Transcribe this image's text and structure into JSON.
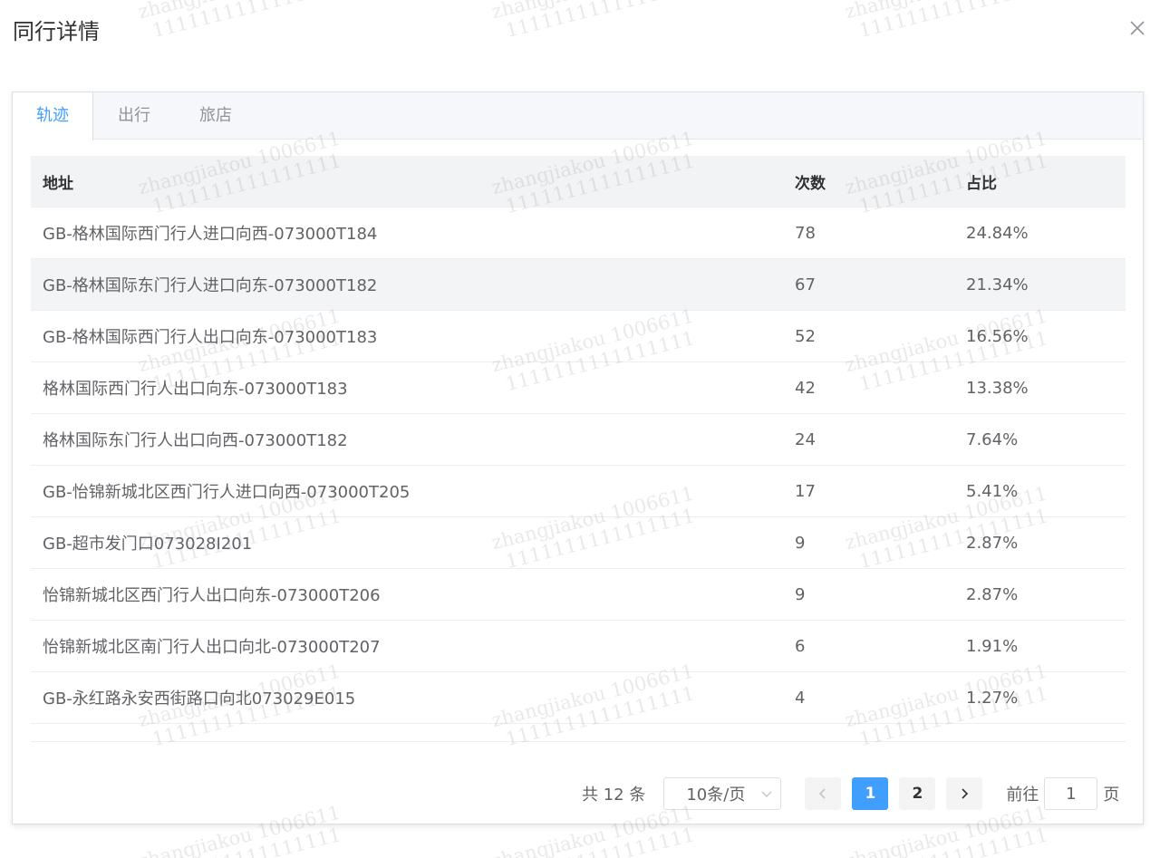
{
  "dialog": {
    "title": "同行详情"
  },
  "tabs": [
    {
      "label": "轨迹",
      "active": true
    },
    {
      "label": "出行",
      "active": false
    },
    {
      "label": "旅店",
      "active": false
    }
  ],
  "table": {
    "columns": [
      "地址",
      "次数",
      "占比"
    ],
    "rows": [
      {
        "address": "GB-格林国际西门行人进口向西-073000T184",
        "count": "78",
        "ratio": "24.84%"
      },
      {
        "address": "GB-格林国际东门行人进口向东-073000T182",
        "count": "67",
        "ratio": "21.34%"
      },
      {
        "address": "GB-格林国际西门行人出口向东-073000T183",
        "count": "52",
        "ratio": "16.56%"
      },
      {
        "address": "格林国际西门行人出口向东-073000T183",
        "count": "42",
        "ratio": "13.38%"
      },
      {
        "address": "格林国际东门行人出口向西-073000T182",
        "count": "24",
        "ratio": "7.64%"
      },
      {
        "address": "GB-怡锦新城北区西门行人进口向西-073000T205",
        "count": "17",
        "ratio": "5.41%"
      },
      {
        "address": "GB-超市发门口073028I201",
        "count": "9",
        "ratio": "2.87%"
      },
      {
        "address": "怡锦新城北区西门行人出口向东-073000T206",
        "count": "9",
        "ratio": "2.87%"
      },
      {
        "address": "怡锦新城北区南门行人出口向北-073000T207",
        "count": "6",
        "ratio": "1.91%"
      },
      {
        "address": "GB-永红路永安西街路口向北073029E015",
        "count": "4",
        "ratio": "1.27%"
      }
    ]
  },
  "pagination": {
    "total_text": "共 12 条",
    "page_size": "10条/页",
    "pages": [
      "1",
      "2"
    ],
    "current_page": "1",
    "goto_label": "前往",
    "goto_value": "1",
    "page_suffix": "页"
  },
  "watermark": {
    "line1": "zhangjiakou 1006611",
    "line2": "1111111111111111"
  },
  "colors": {
    "accent": "#409eff",
    "title": "#303133",
    "text": "#606266",
    "muted": "#909399"
  },
  "icons": [
    "close-icon",
    "chevron-down-icon",
    "chevron-left-icon",
    "chevron-right-icon"
  ]
}
